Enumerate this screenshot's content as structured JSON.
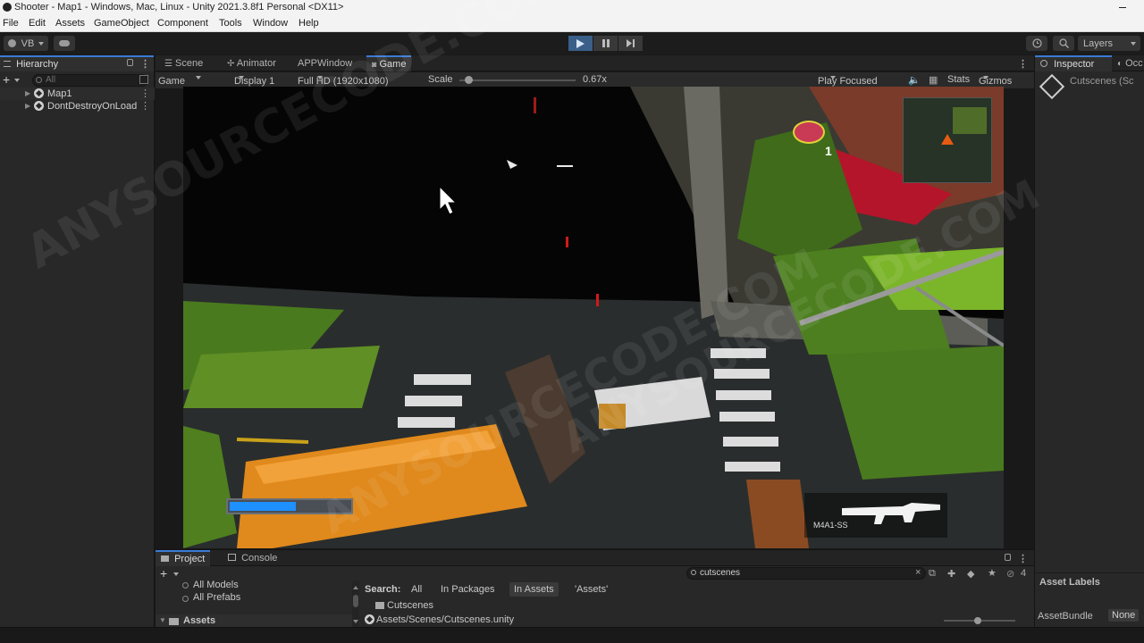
{
  "window": {
    "title": "Shooter - Map1 - Windows, Mac, Linux - Unity 2021.3.8f1 Personal <DX11>"
  },
  "menu": [
    "File",
    "Edit",
    "Assets",
    "GameObject",
    "Component",
    "Tools",
    "Window",
    "Help"
  ],
  "toolbar": {
    "account": "VB",
    "layers": "Layers"
  },
  "hierarchy": {
    "tab": "Hierarchy",
    "search_placeholder": "All",
    "items": [
      "Map1",
      "DontDestroyOnLoad"
    ]
  },
  "center_tabs": [
    "Scene",
    "Animator",
    "APPWindow",
    "Game"
  ],
  "game_toolbar": {
    "view": "Game",
    "display": "Display 1",
    "resolution": "Full HD (1920x1080)",
    "scale_label": "Scale",
    "scale_value": "0.67x",
    "scale_fraction": 0.05,
    "play_mode": "Play Focused",
    "stats": "Stats",
    "gizmos": "Gizmos"
  },
  "hud": {
    "weapon_name": "M4A1-SS",
    "health_fraction": 0.55,
    "minimap_counter": "1"
  },
  "watermark": "ANYSOURCECODE.COM",
  "project": {
    "tabs": [
      "Project",
      "Console"
    ],
    "search_value": "cutscenes",
    "count": "4",
    "tree": [
      "All Models",
      "All Prefabs",
      "Assets"
    ],
    "search_label": "Search:",
    "filters": [
      "All",
      "In Packages",
      "In Assets",
      "'Assets'"
    ],
    "results": [
      "Cutscenes"
    ],
    "path": "Assets/Scenes/Cutscenes.unity"
  },
  "inspector": {
    "tabs": [
      "Inspector",
      "Occ"
    ],
    "object_name": "Cutscenes (Sc",
    "asset_labels": "Asset Labels",
    "asset_bundle_label": "AssetBundle",
    "asset_bundle_value": "None"
  },
  "colors": {
    "accent": "#3a7bd5",
    "play_active": "#3a5f89",
    "health_bar": "#1e90ff"
  }
}
